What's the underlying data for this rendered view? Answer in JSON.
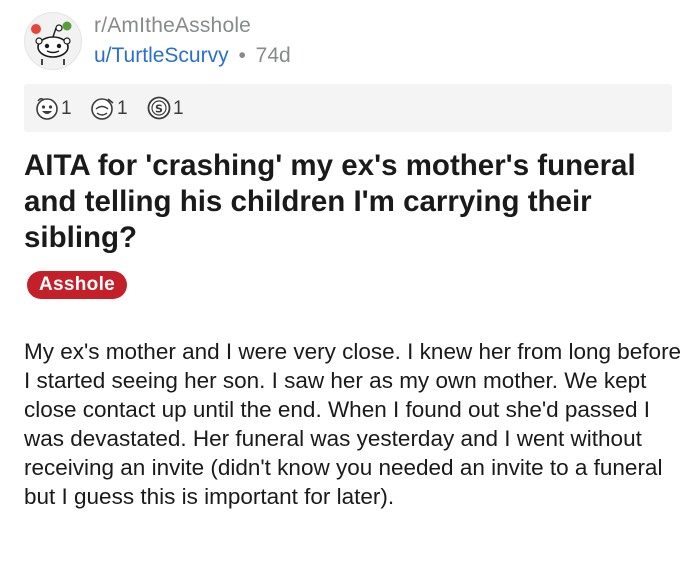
{
  "post": {
    "subreddit": "r/AmItheAsshole",
    "author": "u/TurtleScurvy",
    "separator": "•",
    "age": "74d",
    "awards": [
      {
        "icon": "wholesome-award-icon",
        "count": "1"
      },
      {
        "icon": "helpful-award-icon",
        "count": "1"
      },
      {
        "icon": "silver-award-icon",
        "count": "1"
      }
    ],
    "title": "AITA for 'crashing' my ex's mother's funeral and telling his children I'm carrying their sibling?",
    "flair": "Asshole",
    "flair_color": "#c4202a",
    "body": "My ex's mother and I were very close. I knew her from long before I started seeing her son. I saw her as my own mother. We kept close contact up until the end. When I found out she'd passed I was devastated. Her funeral was yesterday and I went without receiving an invite (didn't know you needed an invite to a funeral but I guess this is important for later)."
  }
}
